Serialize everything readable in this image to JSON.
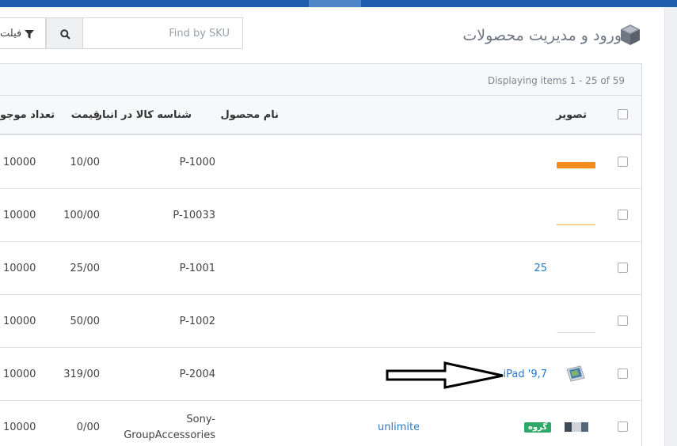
{
  "page": {
    "title": "ورود و مدیریت محصولات"
  },
  "toolbar": {
    "filter_label": "فیلت",
    "search_placeholder": "Find by SKU",
    "search_value": ""
  },
  "grid": {
    "info": "Displaying items 1 - 25 of 59",
    "columns": {
      "image": "تصویر",
      "name": "نام محصول",
      "sku": "شناسه کالا در انبار",
      "price": "قیمت",
      "qty": "تعداد موجو"
    },
    "rows": [
      {
        "name_link": "",
        "sku": "P-1000",
        "price": "10/00",
        "qty": "10000",
        "image_color": "#f28c1c"
      },
      {
        "name_link": "",
        "sku": "P-10033",
        "price": "100/00",
        "qty": "10000",
        "image_color": "#f4d28a"
      },
      {
        "name_link": "25",
        "sku": "P-1001",
        "price": "25/00",
        "qty": "10000",
        "image_color": ""
      },
      {
        "name_link": "",
        "sku": "P-1002",
        "price": "50/00",
        "qty": "10000",
        "image_color": "#e0e0e0"
      },
      {
        "name_link": "iPad '9,7",
        "sku": "P-2004",
        "price": "319/00",
        "qty": "10000",
        "image_color": "#4a7fb3"
      },
      {
        "name_link": "unlimite",
        "sku_line1": "Sony-",
        "sku_line2": "GroupAccessories",
        "price": "0/00",
        "qty": "10000",
        "badge": "گروه",
        "image_color": "#556677"
      }
    ]
  },
  "colors": {
    "topbar": "#1d5fae",
    "link": "#2a78c6",
    "badge": "#2fa869"
  }
}
